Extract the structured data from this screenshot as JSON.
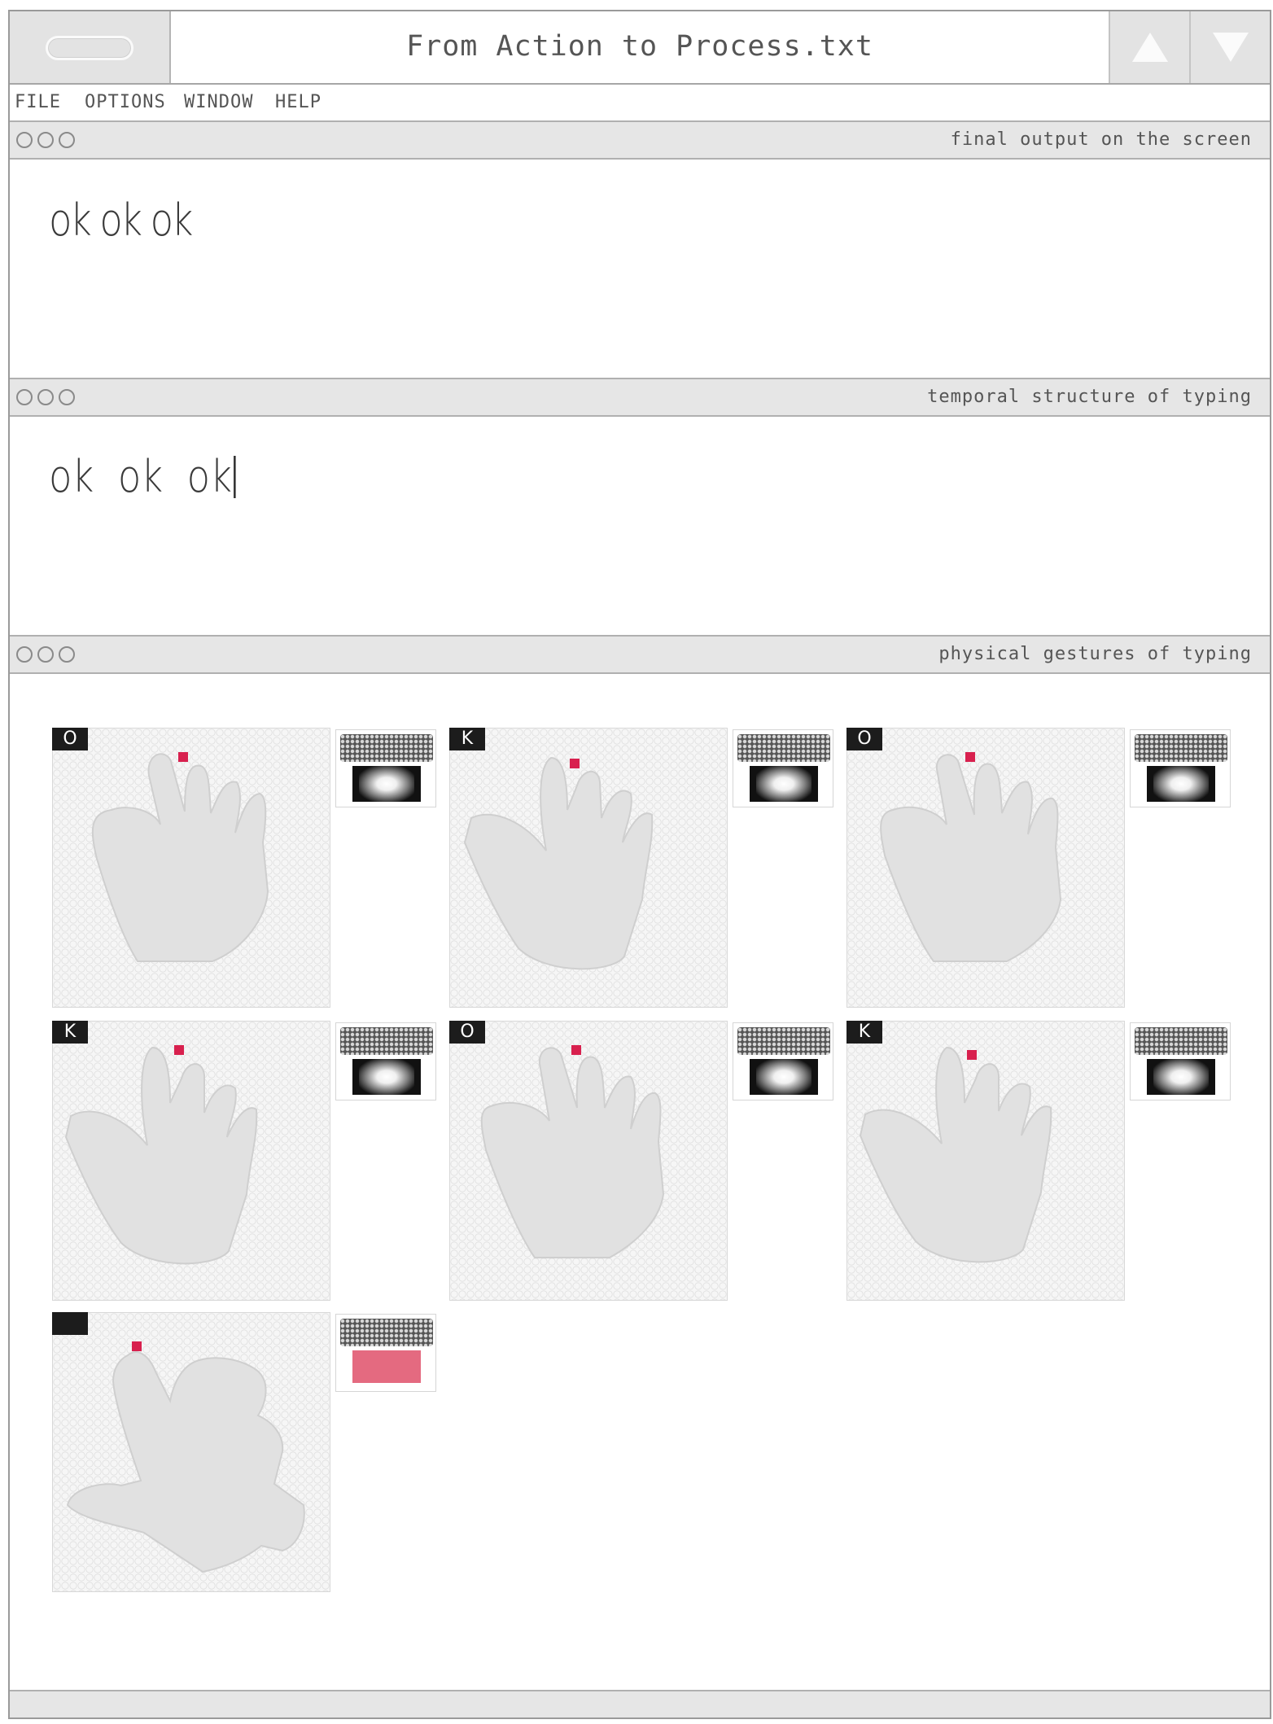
{
  "window": {
    "title": "From Action to Process.txt"
  },
  "menu": {
    "items": [
      "FILE",
      "OPTIONS",
      "WINDOW",
      "HELP"
    ]
  },
  "panels": {
    "final_output": {
      "title": "final output on the screen",
      "text": "ok ok ok"
    },
    "temporal": {
      "title": "temporal structure of typing",
      "text": "ok  ok  ok"
    },
    "gestures": {
      "title": "physical gestures of typing",
      "keys": [
        "O",
        "K",
        "O",
        "K",
        "O",
        "K",
        ""
      ]
    }
  },
  "colors": {
    "cursor": "#d8204e",
    "pressed_trackpad": "#e46a80",
    "hand": "#e0e0e0"
  }
}
